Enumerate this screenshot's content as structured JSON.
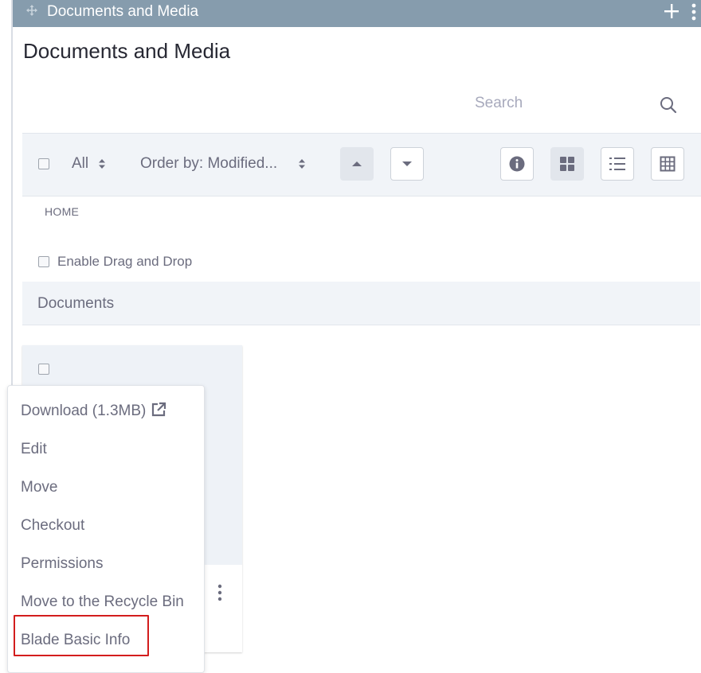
{
  "portlet": {
    "title": "Documents and Media"
  },
  "page": {
    "title": "Documents and Media"
  },
  "search": {
    "placeholder": "Search"
  },
  "toolbar": {
    "filter_label": "All",
    "order_label": "Order by: Modified..."
  },
  "breadcrumb": {
    "home": "HOME"
  },
  "drag_drop": {
    "label": "Enable Drag and Drop"
  },
  "section": {
    "title": "Documents"
  },
  "menu": {
    "items": [
      {
        "label": "Download (1.3MB)"
      },
      {
        "label": "Edit"
      },
      {
        "label": "Move"
      },
      {
        "label": "Checkout"
      },
      {
        "label": "Permissions"
      },
      {
        "label": "Move to the Recycle Bin"
      },
      {
        "label": "Blade Basic Info"
      }
    ]
  },
  "colors": {
    "portlet_bar": "#869cad",
    "text": "#6b6c7e",
    "highlight": "#d31d1d",
    "toolbar_bg": "#f1f4f8"
  }
}
